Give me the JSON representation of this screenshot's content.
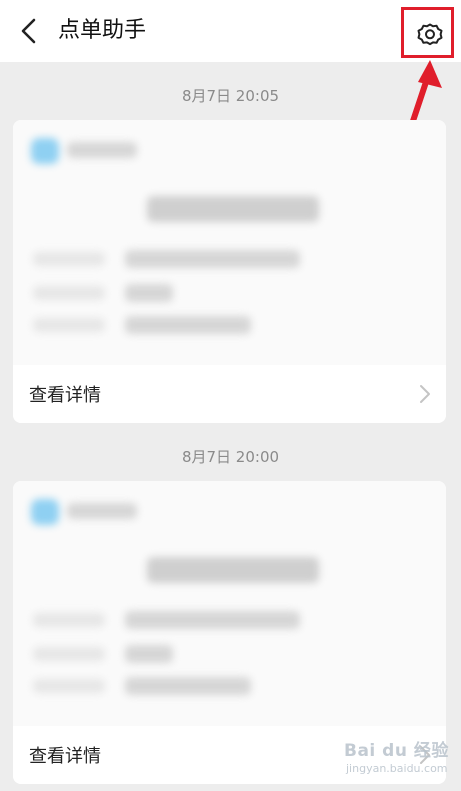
{
  "header": {
    "title": "点单助手",
    "back_icon": "chevron-left-icon",
    "settings_icon": "gear-icon"
  },
  "annotation": {
    "highlight_color": "#e01e2b"
  },
  "messages": [
    {
      "time": "8月7日 20:05",
      "action_label": "查看详情"
    },
    {
      "time": "8月7日 20:00",
      "action_label": "查看详情"
    }
  ],
  "watermark": {
    "brand": "Bai du 经验",
    "url": "jingyan.baidu.com"
  },
  "colors": {
    "background": "#ededed",
    "card": "#ffffff",
    "timestamp": "#8a8a8a",
    "accent_blur": "#8fd0f2"
  }
}
